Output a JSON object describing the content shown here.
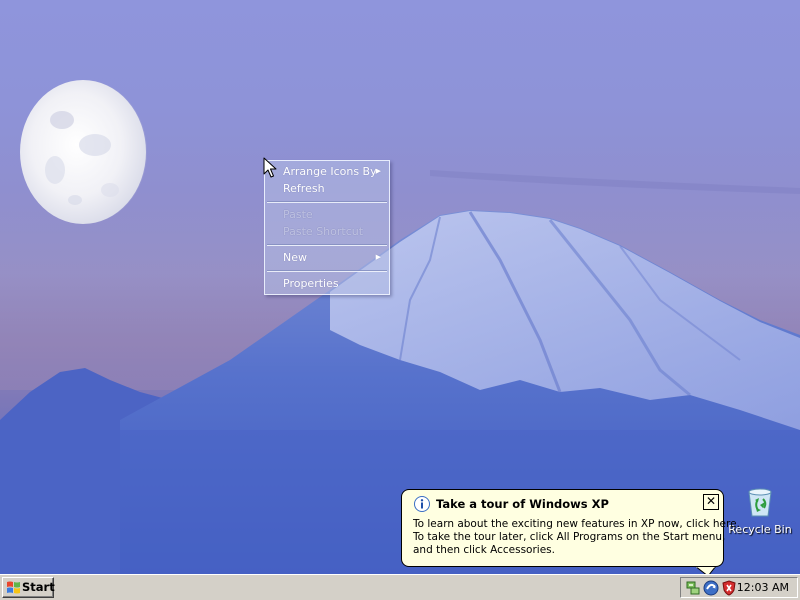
{
  "desktop": {
    "wallpaper": "moon-over-snowy-mountain",
    "icons": [
      {
        "label": "Recycle Bin",
        "icon": "recycle-bin-icon"
      }
    ]
  },
  "context_menu": {
    "items": [
      {
        "label": "Arrange Icons By",
        "enabled": true,
        "submenu": true
      },
      {
        "label": "Refresh",
        "enabled": true,
        "submenu": false
      },
      {
        "label": "Paste",
        "enabled": false,
        "submenu": false
      },
      {
        "label": "Paste Shortcut",
        "enabled": false,
        "submenu": false
      },
      {
        "label": "New",
        "enabled": true,
        "submenu": true
      },
      {
        "label": "Properties",
        "enabled": true,
        "submenu": false
      }
    ]
  },
  "balloon": {
    "icon": "info-icon",
    "title": "Take a tour of Windows XP",
    "close_label": "✕",
    "body_lines": [
      "To learn about the exciting new features in XP now, click here.",
      "To take the tour later, click All Programs on the Start menu,",
      "and then click Accessories."
    ],
    "background_color": "#ffffe1"
  },
  "taskbar": {
    "start_label": "Start",
    "clock": "12:03 AM",
    "tray_icons": [
      "network-icon",
      "windows-update-icon",
      "security-shield-icon"
    ],
    "color": "#d4d0c8"
  },
  "colors": {
    "menu_text": "#ffffff",
    "desktop_sky": "#8f95dc",
    "mountain_blue": "#4f67c6"
  }
}
